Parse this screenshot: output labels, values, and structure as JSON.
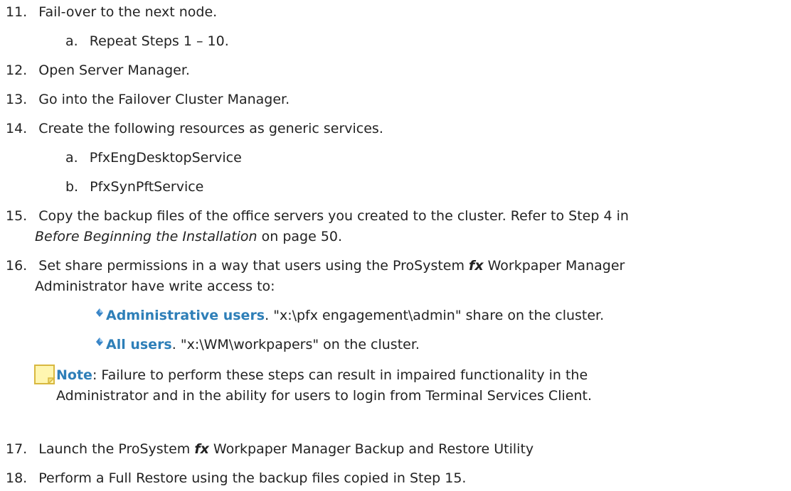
{
  "steps": [
    {
      "num": "11.",
      "text": "Fail-over to the next node."
    },
    {
      "sub": "a.",
      "text": "Repeat Steps 1 – 10."
    },
    {
      "num": "12.",
      "text": "Open Server Manager."
    },
    {
      "num": "13.",
      "text": "Go into the Failover Cluster Manager."
    },
    {
      "num": "14.",
      "text": "Create the following resources as generic services."
    },
    {
      "sub": "a.",
      "text": "PfxEngDesktopService"
    },
    {
      "sub": "b.",
      "text": "PfxSynPftService"
    },
    {
      "num": "15.",
      "text1": "Copy the backup files of the office servers you created to the cluster. Refer to Step 4 in",
      "text2_italic": "Before Beginning the Installation",
      "text2_rest": " on page 50."
    },
    {
      "num": "16.",
      "text1": "Set share permissions in a way that users using the ProSystem ",
      "italic_fx": "fx",
      "text1_rest": " Workpaper Manager",
      "text2": "Administrator have write access to:"
    },
    {
      "bullet_bold": "Administrative users",
      "bullet_text": ". \"x:\\pfx engagement\\admin\" share on the cluster."
    },
    {
      "bullet_bold": "All users",
      "bullet_text": ". \"x:\\WM\\workpapers\" on the cluster."
    },
    {
      "note_label": "Note",
      "note_text1": ": Failure to perform these steps can result in impaired functionality in the",
      "note_text2": "Administrator and in the ability for users to login from Terminal Services Client."
    },
    {
      "num": "17.",
      "text1": "Launch the ProSystem ",
      "italic_fx": "fx",
      "text1_rest": " Workpaper Manager Backup and Restore Utility"
    },
    {
      "num": "18.",
      "text": "Perform a Full Restore using the backup files copied in Step 15."
    }
  ],
  "icons": {
    "bullet": "diamond-bullet-icon",
    "note": "sticky-note-icon"
  },
  "colors": {
    "accent": "#2e7fb8",
    "note_fill": "#fff6b0",
    "note_border": "#d8b840"
  }
}
